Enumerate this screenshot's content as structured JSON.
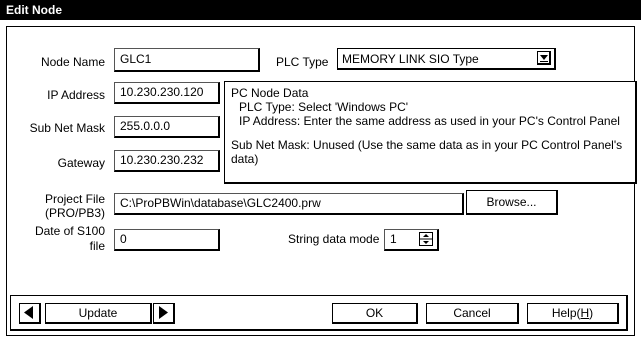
{
  "window": {
    "title": "Edit Node"
  },
  "fields": {
    "node_name": {
      "label": "Node Name",
      "value": "GLC1"
    },
    "plc_type": {
      "label": "PLC Type",
      "value": "MEMORY LINK SIO Type"
    },
    "ip_address": {
      "label": "IP Address",
      "value": "10.230.230.120"
    },
    "subnet_mask": {
      "label": "Sub Net Mask",
      "value": "255.0.0.0"
    },
    "gateway": {
      "label": "Gateway",
      "value": "10.230.230.232"
    },
    "project_file": {
      "label_line1": "Project File",
      "label_line2": "(PRO/PB3)",
      "value": "C:\\ProPBWin\\database\\GLC2400.prw"
    },
    "date_s100": {
      "label_line1": "Date of S100",
      "label_line2": "file",
      "value": "0"
    },
    "string_mode": {
      "label": "String data mode",
      "value": "1"
    }
  },
  "tooltip": {
    "title": "PC Node Data",
    "line1": "PLC Type: Select 'Windows PC'",
    "line2": "IP Address: Enter the same address as used in your PC's Control Panel",
    "line3": "Sub Net Mask: Unused (Use the same data as in your PC Control Panel's",
    "line4": "data)"
  },
  "buttons": {
    "browse": "Browse...",
    "update": "Update",
    "ok": "OK",
    "cancel": "Cancel",
    "help_prefix": "Help(",
    "help_key": "H",
    "help_suffix": ")"
  },
  "icons": {
    "dropdown": "dropdown-arrow-icon",
    "prev": "left-triangle-icon",
    "next": "right-triangle-icon",
    "spinner": "spinner-icon"
  }
}
